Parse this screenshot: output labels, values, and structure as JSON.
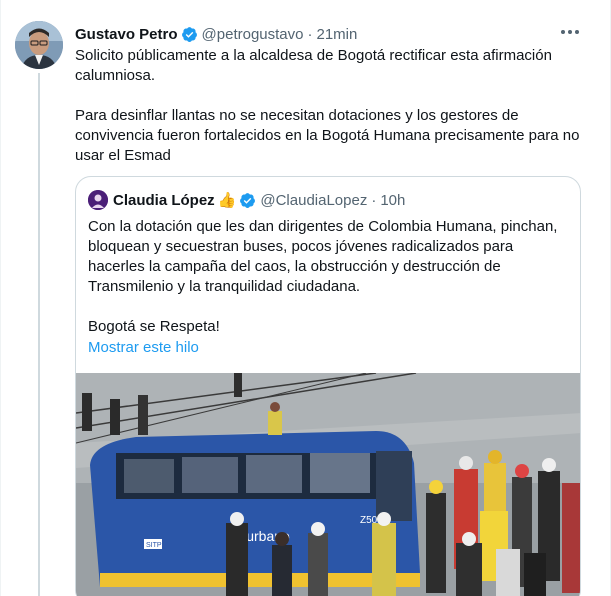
{
  "tweet": {
    "author_name": "Gustavo Petro",
    "author_handle": "@petrogustavo",
    "separator": "·",
    "time": "21min",
    "paragraph_1": "Solicito públicamente a la alcaldesa de Bogotá rectificar esta afirmación calumniosa.",
    "paragraph_2": "Para desinflar llantas no se necesitan dotaciones y los gestores de convivencia fueron fortalecidos en la Bogotá Humana precisamente para no usar el Esmad",
    "avatar_icon": "profile-photo",
    "verified_icon": "verified-badge-icon",
    "more_icon": "more-options-icon"
  },
  "quoted_tweet": {
    "author_name": "Claudia López",
    "author_emoji": "👍",
    "author_handle": "@ClaudiaLopez",
    "separator": "·",
    "time": "10h",
    "paragraph_1": "Con la dotación que les dan dirigentes de Colombia Humana, pinchan, bloquean y secuestran buses, pocos jóvenes radicalizados para hacerles la campaña del caos, la obstrucción y destrucción de Transmilenio y la tranquilidad ciudadana.",
    "paragraph_2": "Bogotá se Respeta!",
    "show_thread_label": "Mostrar este hilo",
    "media_description_icon": "photo-bus-crowd",
    "bus_sign": "SITP",
    "bus_text": "Sit urbano",
    "bus_code": "Z50-2"
  },
  "colors": {
    "text": "#0f1419",
    "muted": "#536471",
    "link": "#1d9bf0",
    "verified": "#1d9bf0",
    "border": "#cfd9de"
  }
}
